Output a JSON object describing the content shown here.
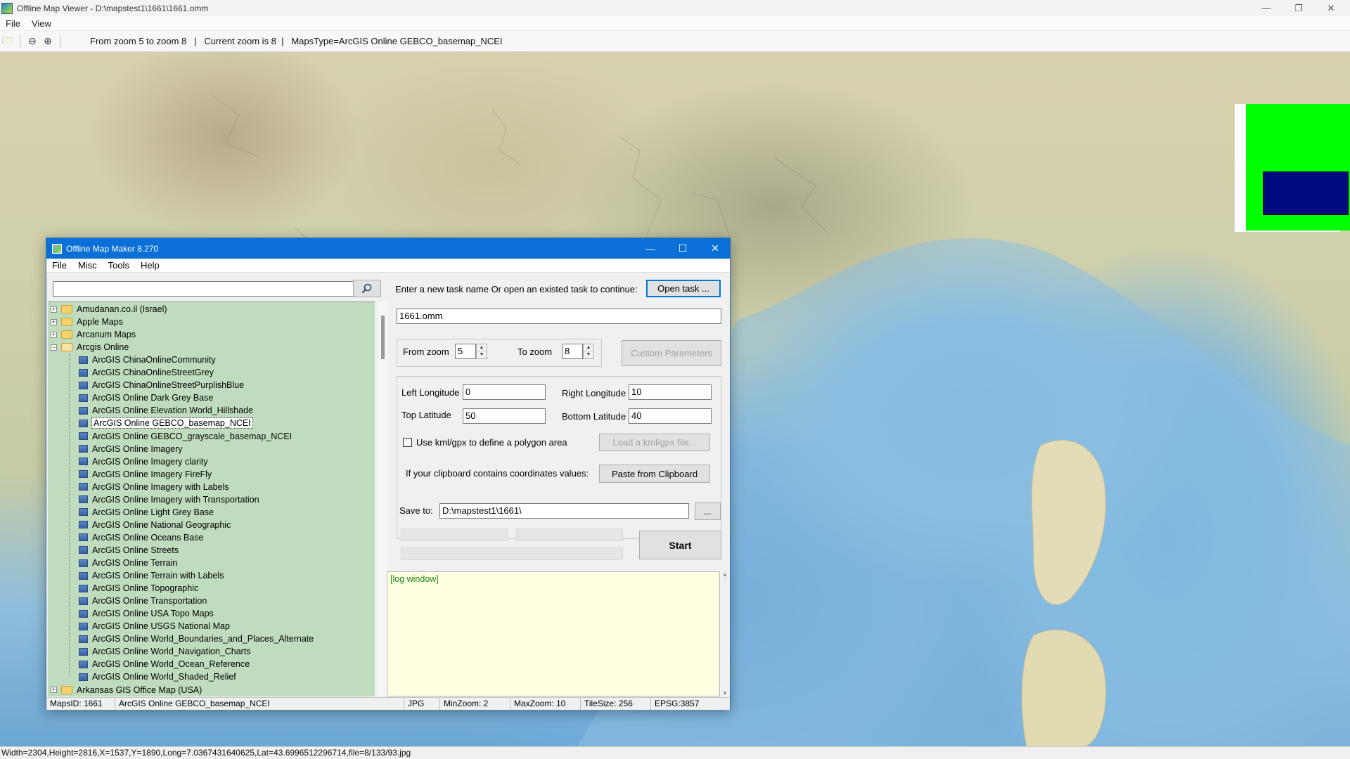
{
  "viewer": {
    "title": "Offline Map Viewer - D:\\mapstest1\\1661\\1661.omm",
    "menu": [
      "File",
      "View"
    ],
    "toolbar_info": "From zoom 5 to zoom 8   |   Current zoom is 8  |   MapsType=ArcGIS Online GEBCO_basemap_NCEI",
    "status": "Width=2304,Height=2816,X=1537,Y=1890,Long=7.0367431640625,Lat=43.6996512296714,file=8/133/93.jpg",
    "minimap_colors": {
      "background": "#00ff00",
      "viewport": "#000a80"
    }
  },
  "maker": {
    "title": "Offline Map Maker 8.270",
    "menu": [
      "File",
      "Misc",
      "Tools",
      "Help"
    ],
    "search": {
      "value": "",
      "placeholder": ""
    },
    "tree": {
      "folders_before": [
        "Amudanan.co.il (Israel)",
        "Apple Maps",
        "Arcanum Maps"
      ],
      "open_folder": "Arcgis Online",
      "children": [
        "ArcGIS ChinaOnlineCommunity",
        "ArcGIS ChinaOnlineStreetGrey",
        "ArcGIS ChinaOnlineStreetPurplishBlue",
        "ArcGIS Online Dark Grey Base",
        "ArcGIS Online Elevation World_Hillshade",
        "ArcGIS Online GEBCO_basemap_NCEI",
        "ArcGIS Online GEBCO_grayscale_basemap_NCEI",
        "ArcGIS Online Imagery",
        "ArcGIS Online Imagery clarity",
        "ArcGIS Online Imagery FireFly",
        "ArcGIS Online Imagery with Labels",
        "ArcGIS Online Imagery with Transportation",
        "ArcGIS Online Light Grey Base",
        "ArcGIS Online National Geographic",
        "ArcGIS Online Oceans Base",
        "ArcGIS Online Streets",
        "ArcGIS Online Terrain",
        "ArcGIS Online Terrain with Labels",
        "ArcGIS Online Topographic",
        "ArcGIS Online Transportation",
        "ArcGIS Online USA Topo Maps",
        "ArcGIS Online USGS National Map",
        "ArcGIS Online World_Boundaries_and_Places_Alternate",
        "ArcGIS Online World_Navigation_Charts",
        "ArcGIS Online World_Ocean_Reference",
        "ArcGIS Online World_Shaded_Relief"
      ],
      "selected": "ArcGIS Online GEBCO_basemap_NCEI",
      "folders_after": [
        "Arkansas GIS Office Map (USA)"
      ]
    },
    "task_prompt": "Enter a new task name Or open an existed task to continue:",
    "open_task": "Open task ...",
    "task_name": "1661.omm",
    "from_zoom_label": "From zoom",
    "from_zoom": "5",
    "to_zoom_label": "To zoom",
    "to_zoom": "8",
    "custom_params": "Custom Parameters",
    "left_lon_label": "Left Longitude",
    "left_lon": "0",
    "right_lon_label": "Right Longitude",
    "right_lon": "10",
    "top_lat_label": "Top Latitude",
    "top_lat": "50",
    "bottom_lat_label": "Bottom Latitude",
    "bottom_lat": "40",
    "kml_label": "Use kml/gpx to define a polygon area",
    "load_kml": "Load a kml/gpx file...",
    "clipboard_label": "If your clipboard contains coordinates values:",
    "paste_clipboard": "Paste from Clipboard",
    "save_to_label": "Save to:",
    "save_to": "D:\\mapstest1\\1661\\",
    "browse": "...",
    "start": "Start",
    "log": "[log window]",
    "status": {
      "maps_id": "MapsID: 1661",
      "name": "ArcGIS Online GEBCO_basemap_NCEI",
      "format": "JPG",
      "min_zoom": "MinZoom: 2",
      "max_zoom": "MaxZoom: 10",
      "tile_size": "TileSize: 256",
      "epsg": "EPSG:3857"
    }
  }
}
